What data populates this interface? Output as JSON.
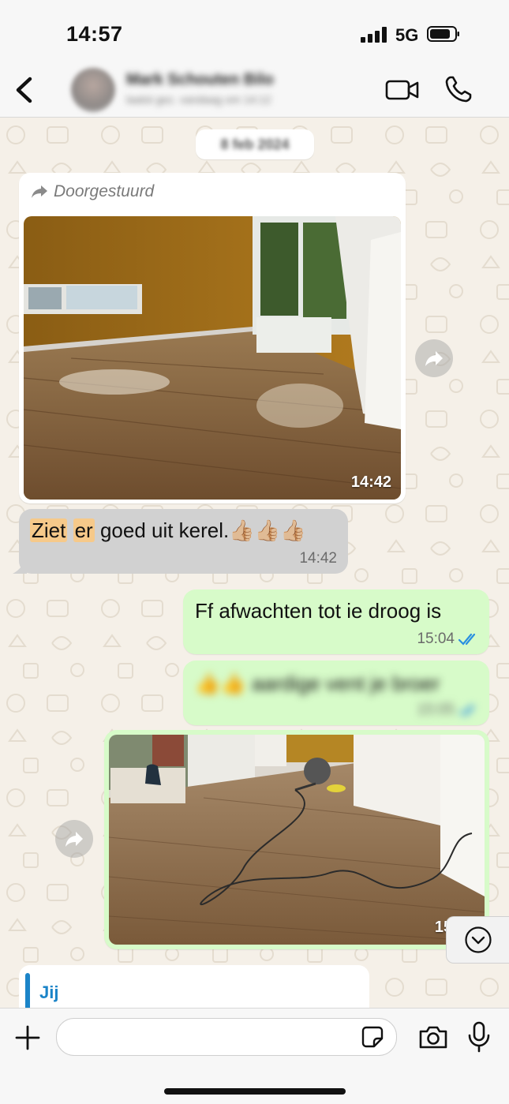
{
  "status_bar": {
    "time": "14:57",
    "network": "5G"
  },
  "header": {
    "contact_name": "Mark Schouten Bilo",
    "contact_status": "laatst gez. vandaag om 14:12"
  },
  "chat": {
    "date_chip": "8 feb 2024",
    "forwarded_photo": {
      "forward_label": "Doorgestuurd",
      "time": "14:42"
    },
    "messages": [
      {
        "direction": "incoming",
        "text_highlight_1": "Ziet",
        "text_highlight_2": "er",
        "text_rest": "goed uit kerel.",
        "emoji": "👍🏼👍🏼👍🏼",
        "time": "14:42"
      },
      {
        "direction": "outgoing",
        "text": "Ff afwachten tot ie droog is",
        "time": "15:04",
        "status": "read"
      },
      {
        "direction": "outgoing",
        "text": "👍👍 aardige vent je broer",
        "time": "15:05",
        "status": "read"
      },
      {
        "direction": "outgoing_photo",
        "time": "15:05"
      }
    ],
    "reply_preview": {
      "author": "Jij"
    }
  },
  "input_bar": {
    "placeholder": ""
  },
  "colors": {
    "accent": "#1b84c8",
    "outgoing_bubble": "#d7fbc9",
    "read_ticks": "#2a8fe0",
    "incoming_selected": "#d1d1d1"
  },
  "icons": [
    "back-chevron-icon",
    "video-call-icon",
    "phone-icon",
    "forward-arrow-icon",
    "share-icon",
    "double-check-icon",
    "chevron-down-icon",
    "plus-icon",
    "sticker-icon",
    "camera-icon",
    "mic-icon"
  ]
}
